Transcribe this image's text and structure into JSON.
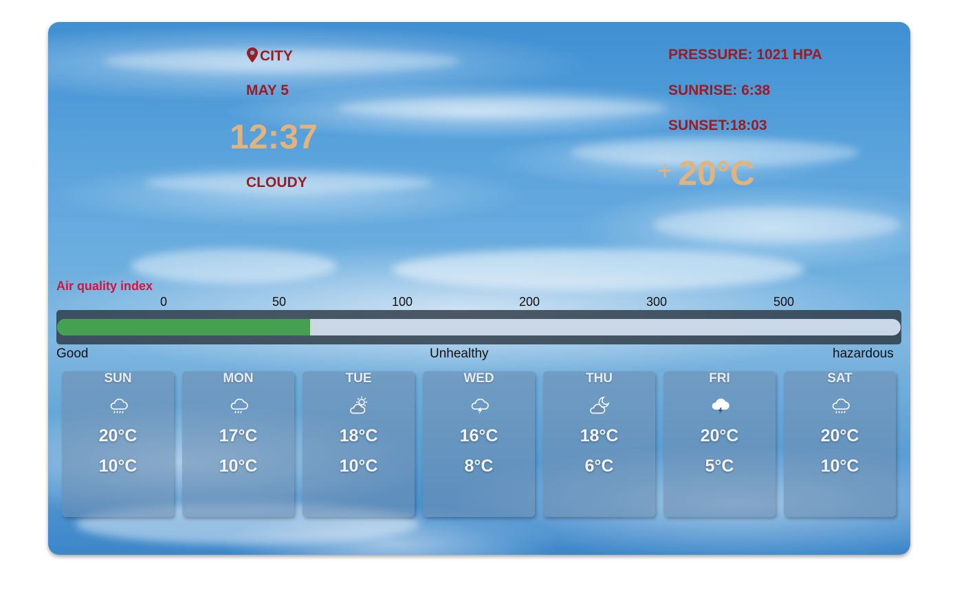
{
  "location": {
    "city": "CITY",
    "icon": "map-pin-icon"
  },
  "date": "MAY 5",
  "time": "12:37",
  "condition": "CLOUDY",
  "pressure": "PRESSURE: 1021 HPA",
  "sunrise": "SUNRISE: 6:38",
  "sunset": "SUNSET:18:03",
  "temperature": {
    "sign": "+",
    "value": "20°C"
  },
  "colors": {
    "label_red": "#9b1c22",
    "accent_tan": "#e0b47e",
    "aqi_title": "#d4143f",
    "aqi_fill": "#46a051"
  },
  "aqi": {
    "title": "Air quality index",
    "ticks": [
      "0",
      "50",
      "100",
      "200",
      "300",
      "500"
    ],
    "fill_fraction": 0.3,
    "labels": {
      "good": "Good",
      "unhealthy": "Unhealthy",
      "hazardous": "hazardous"
    }
  },
  "forecast": [
    {
      "day": "SUN",
      "icon": "rain-cloud-icon",
      "high": "20°C",
      "low": "10°C"
    },
    {
      "day": "MON",
      "icon": "rain-cloud-icon",
      "high": "17°C",
      "low": "10°C"
    },
    {
      "day": "TUE",
      "icon": "sun-behind-cloud-icon",
      "high": "18°C",
      "low": "10°C"
    },
    {
      "day": "WED",
      "icon": "thunder-cloud-icon",
      "high": "16°C",
      "low": "8°C"
    },
    {
      "day": "THU",
      "icon": "moon-behind-cloud-icon",
      "high": "18°C",
      "low": "6°C"
    },
    {
      "day": "FRI",
      "icon": "thunderstorm-icon",
      "high": "20°C",
      "low": "5°C"
    },
    {
      "day": "SAT",
      "icon": "rain-cloud-icon",
      "high": "20°C",
      "low": "10°C"
    }
  ]
}
